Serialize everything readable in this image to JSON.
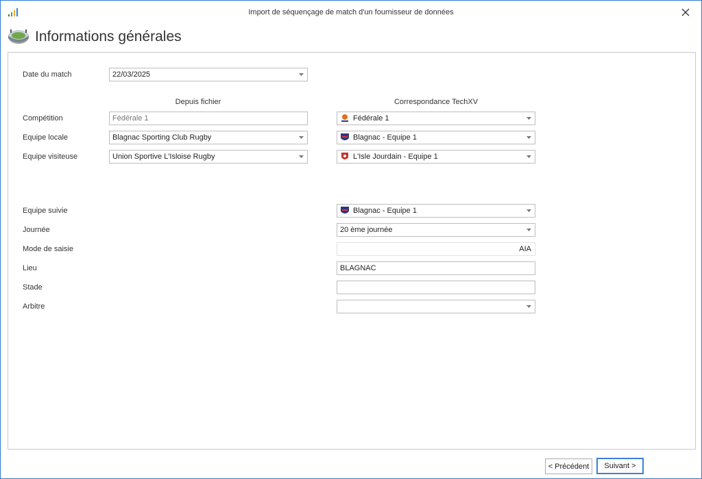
{
  "window": {
    "title": "Import de séquençage de match d'un fournisseur de données"
  },
  "header": {
    "title": "Informations générales",
    "icon": "stadium-icon"
  },
  "labels": {
    "date_du_match": "Date du match",
    "competition": "Compétition",
    "equipe_locale": "Equipe locale",
    "equipe_visiteuse": "Equipe visiteuse",
    "equipe_suivie": "Equipe suivie",
    "journee": "Journée",
    "mode_de_saisie": "Mode de saisie",
    "lieu": "Lieu",
    "stade": "Stade",
    "arbitre": "Arbitre"
  },
  "columns": {
    "file": "Depuis fichier",
    "techxv": "Correspondance TechXV"
  },
  "fields": {
    "date": "22/03/2025",
    "file_competition": "Fédérale 1",
    "file_home": "Blagnac Sporting Club Rugby",
    "file_away": "Union Sportive L'Isloise Rugby",
    "tx_competition": "Fédérale 1",
    "tx_home": "Blagnac - Equipe 1",
    "tx_away": "L'Isle Jourdain - Equipe 1",
    "tracked_team": "Blagnac - Equipe 1",
    "matchday": "20 ème journée",
    "input_mode": "AIA",
    "venue": "BLAGNAC",
    "stadium": "",
    "referee": ""
  },
  "buttons": {
    "previous": "< Précédent",
    "next": "Suivant >"
  },
  "colors": {
    "accent": "#3c7fd1",
    "blagnac_logo": "#2b3a7a",
    "isle_logo": "#c0392b",
    "ffr_logo": "#e07020"
  }
}
